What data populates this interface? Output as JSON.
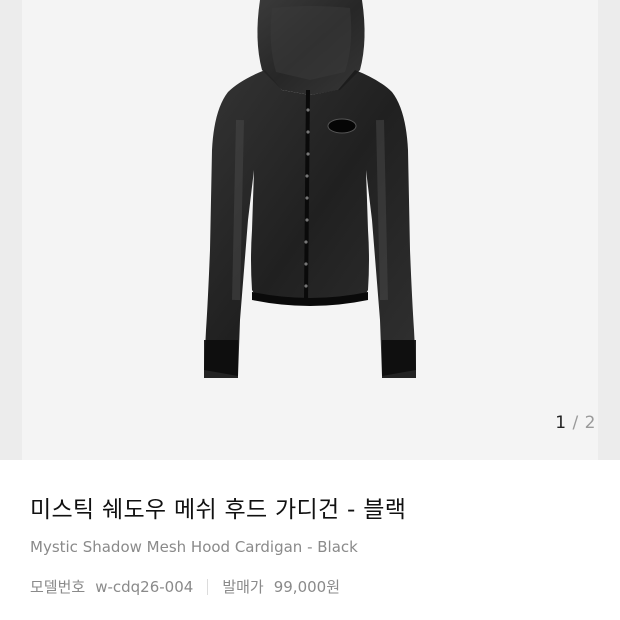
{
  "gallery": {
    "image_alt": "black mesh hooded cardigan",
    "current": "1",
    "separator": "/",
    "total": "2"
  },
  "product": {
    "title_ko": "미스틱 쉐도우 메쉬 후드 가디건 - 블랙",
    "title_en": "Mystic Shadow Mesh Hood Cardigan - Black",
    "model_label": "모델번호",
    "model_value": "w-cdq26-004",
    "price_label": "발매가",
    "price_value": "99,000원"
  }
}
